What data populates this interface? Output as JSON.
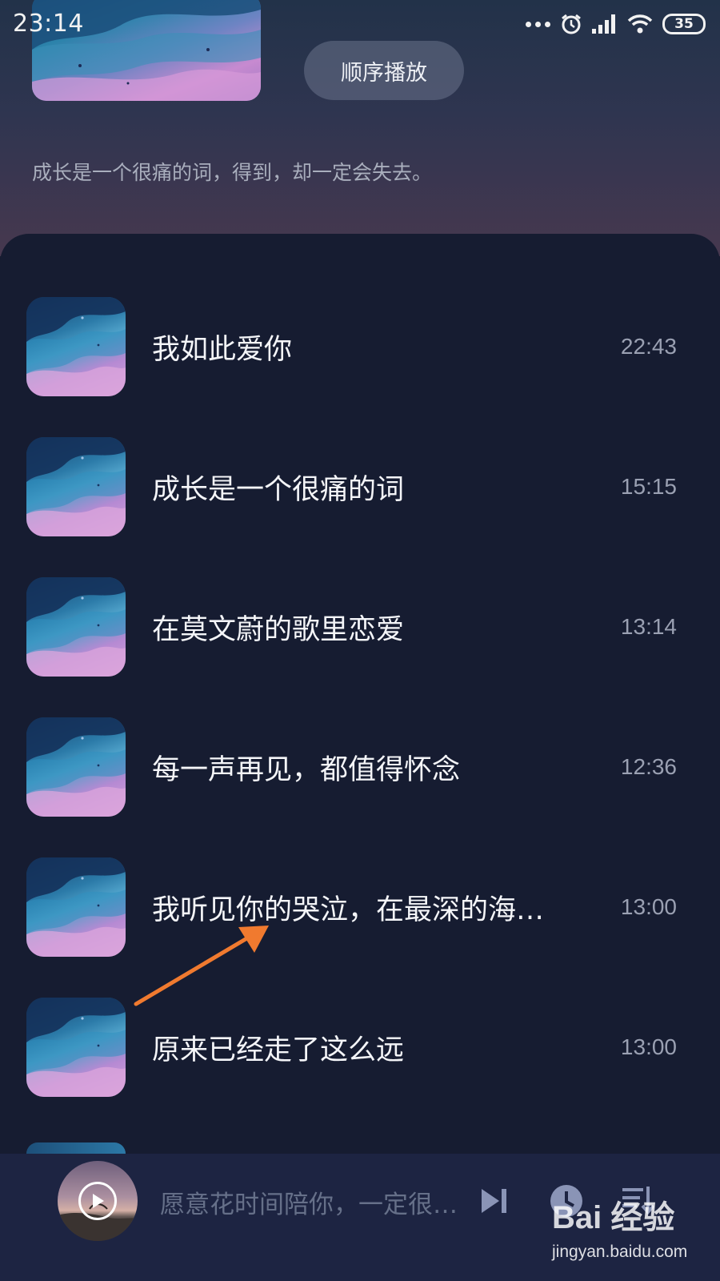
{
  "status": {
    "time": "23:14",
    "battery": "35",
    "icons": [
      "more-dots-icon",
      "alarm-icon",
      "signal-icon",
      "wifi-icon",
      "battery-icon"
    ]
  },
  "header": {
    "play_mode": "顺序播放",
    "tagline": "成长是一个很痛的词，得到，却一定会失去。"
  },
  "tracks": [
    {
      "title": "我如此爱你",
      "duration": "22:43"
    },
    {
      "title": "成长是一个很痛的词",
      "duration": "15:15"
    },
    {
      "title": "在莫文蔚的歌里恋爱",
      "duration": "13:14"
    },
    {
      "title": "每一声再见，都值得怀念",
      "duration": "12:36"
    },
    {
      "title": "我听见你的哭泣，在最深的海…",
      "duration": "13:00"
    },
    {
      "title": "原来已经走了这么远",
      "duration": "13:00"
    }
  ],
  "player": {
    "now_playing": "愿意花时间陪你，一定很…",
    "controls": [
      "play-icon",
      "next-track-icon",
      "timer-icon",
      "playlist-icon"
    ]
  },
  "watermark": {
    "main": "Bai 经验",
    "sub": "jingyan.baidu.com"
  },
  "colors": {
    "background": "#161c31",
    "player_bar": "#1d2442",
    "annotation_arrow": "#f07a2f"
  }
}
